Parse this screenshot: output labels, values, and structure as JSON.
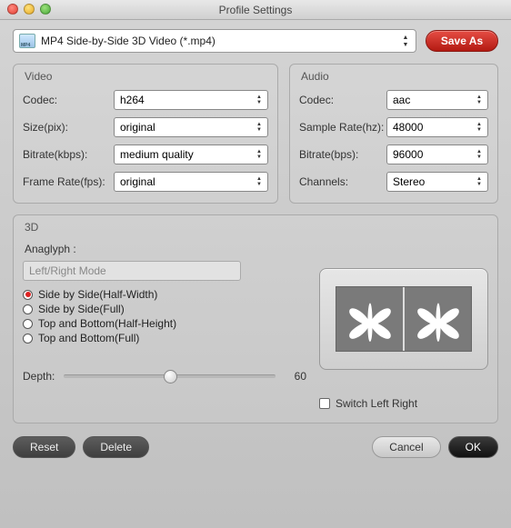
{
  "window": {
    "title": "Profile Settings"
  },
  "profile": {
    "selected": "MP4 Side-by-Side 3D Video (*.mp4)",
    "save_as_label": "Save As"
  },
  "video": {
    "title": "Video",
    "codec_label": "Codec:",
    "codec": "h264",
    "size_label": "Size(pix):",
    "size": "original",
    "bitrate_label": "Bitrate(kbps):",
    "bitrate": "medium quality",
    "framerate_label": "Frame Rate(fps):",
    "framerate": "original"
  },
  "audio": {
    "title": "Audio",
    "codec_label": "Codec:",
    "codec": "aac",
    "samplerate_label": "Sample Rate(hz):",
    "samplerate": "48000",
    "bitrate_label": "Bitrate(bps):",
    "bitrate": "96000",
    "channels_label": "Channels:",
    "channels": "Stereo"
  },
  "three_d": {
    "title": "3D",
    "anaglyph_label": "Anaglyph :",
    "anaglyph_value": "Left/Right Mode",
    "modes": [
      {
        "label": "Side by Side(Half-Width)",
        "selected": true
      },
      {
        "label": "Side by Side(Full)",
        "selected": false
      },
      {
        "label": "Top and Bottom(Half-Height)",
        "selected": false
      },
      {
        "label": "Top and Bottom(Full)",
        "selected": false
      }
    ],
    "depth_label": "Depth:",
    "depth_value": "60",
    "depth_percent": 50,
    "switch_label": "Switch Left Right",
    "switch_checked": false
  },
  "footer": {
    "reset": "Reset",
    "delete": "Delete",
    "cancel": "Cancel",
    "ok": "OK"
  }
}
